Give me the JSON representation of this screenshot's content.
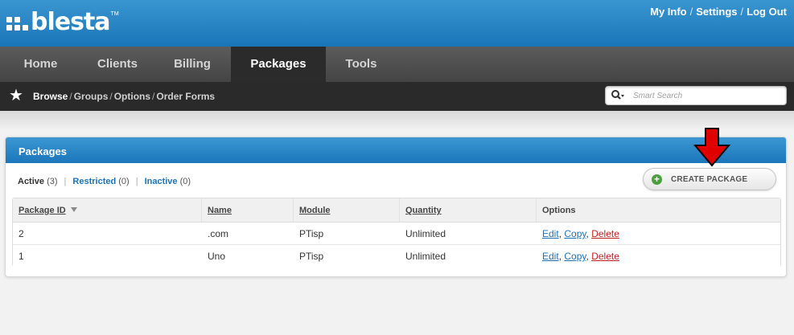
{
  "header": {
    "logo_text": "blesta",
    "logo_tm": "TM",
    "links": [
      "My Info",
      "Settings",
      "Log Out"
    ],
    "link_separator": "/",
    "brand_color": "#1a75b8"
  },
  "nav": {
    "tabs": [
      {
        "label": "Home",
        "active": false
      },
      {
        "label": "Clients",
        "active": false
      },
      {
        "label": "Billing",
        "active": false
      },
      {
        "label": "Packages",
        "active": true
      },
      {
        "label": "Tools",
        "active": false
      }
    ]
  },
  "subnav": {
    "star_icon": "star-icon",
    "current": "Browse",
    "links": [
      "Groups",
      "Options",
      "Order Forms"
    ],
    "separator": "/"
  },
  "search": {
    "placeholder": "Smart Search",
    "icon": "search-icon"
  },
  "panel": {
    "title": "Packages",
    "filters": [
      {
        "label": "Active",
        "count": "(3)",
        "active": true
      },
      {
        "label": "Restricted",
        "count": "(0)",
        "active": false
      },
      {
        "label": "Inactive",
        "count": "(0)",
        "active": false
      }
    ],
    "create_button": "CREATE PACKAGE",
    "table": {
      "columns": [
        "Package ID",
        "Name",
        "Module",
        "Quantity",
        "Options"
      ],
      "rows": [
        {
          "id": "2",
          "name": ".com",
          "module": "PTisp",
          "quantity": "Unlimited"
        },
        {
          "id": "1",
          "name": "Uno",
          "module": "PTisp",
          "quantity": "Unlimited"
        }
      ],
      "options": {
        "edit": "Edit",
        "copy": "Copy",
        "delete": "Delete",
        "comma": ","
      }
    }
  },
  "colors": {
    "link_blue": "#1e72b5",
    "delete_red": "#c02020",
    "annotation_arrow": "#e00000"
  }
}
